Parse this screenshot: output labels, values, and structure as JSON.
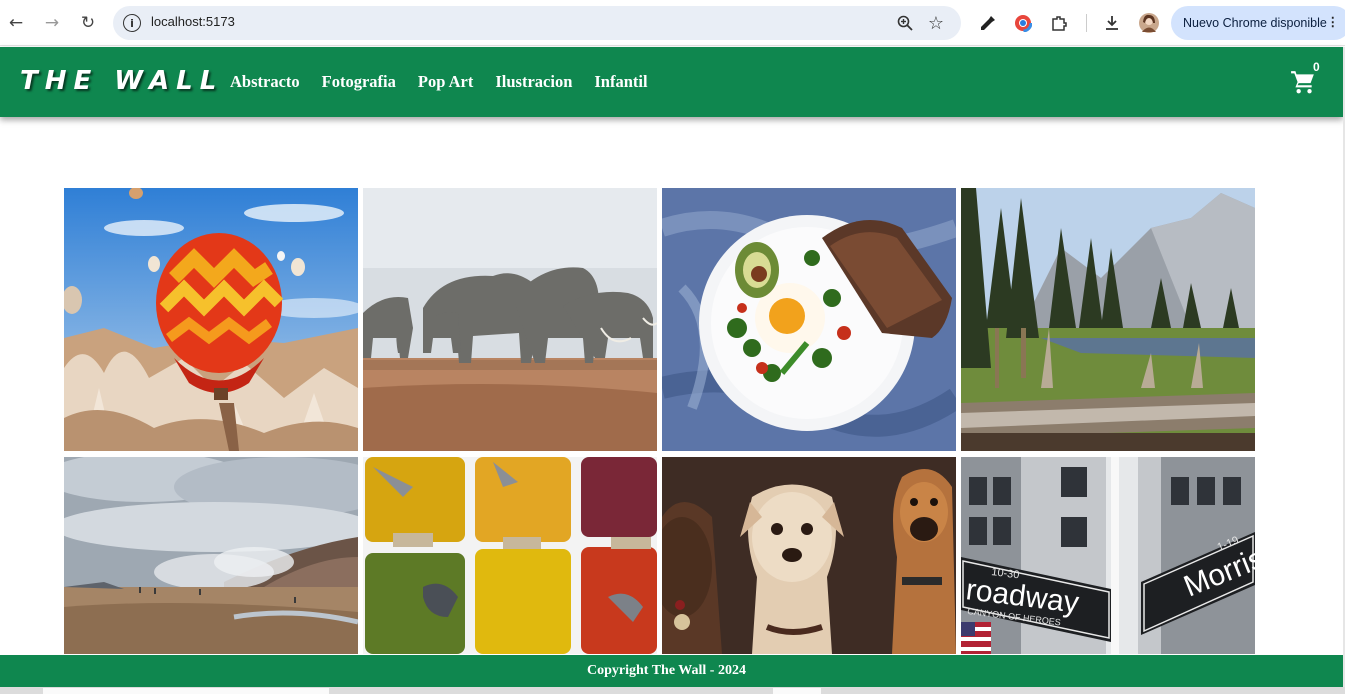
{
  "browser": {
    "url": "localhost:5173",
    "update_label": "Nuevo Chrome disponible",
    "icons": [
      "back-arrow-icon",
      "forward-arrow-icon",
      "reload-icon",
      "site-info-icon",
      "zoom-icon",
      "bookmark-star-icon",
      "eyedropper-icon",
      "color-extension-icon",
      "extensions-puzzle-icon",
      "download-icon",
      "profile-avatar",
      "menu-dots-icon"
    ]
  },
  "header": {
    "logo": "THE WALL",
    "menu": [
      "Abstracto",
      "Fotografia",
      "Pop Art",
      "Ilustracion",
      "Infantil"
    ],
    "cart_count": "0",
    "color": "#0f874f"
  },
  "gallery": {
    "images": [
      {
        "subject": "hot air balloon over rocky valley"
      },
      {
        "subject": "herd of elephants on savanna"
      },
      {
        "subject": "plate with egg, avocado and bread"
      },
      {
        "subject": "forest meadow with mountains"
      },
      {
        "subject": "cloudy steaming volcanic field"
      },
      {
        "subject": "bowls of colorful spices"
      },
      {
        "subject": "three dogs portrait"
      },
      {
        "subject": "Broadway and Morris street signs"
      }
    ],
    "sign_text": {
      "broadway": "roadway",
      "broadway_sub": "CANYON OF HEROES",
      "broadway_num": "10-30",
      "morris": "Morris",
      "morris_num": "1-19"
    }
  },
  "footer": {
    "text": "Copyright The Wall - 2024"
  }
}
